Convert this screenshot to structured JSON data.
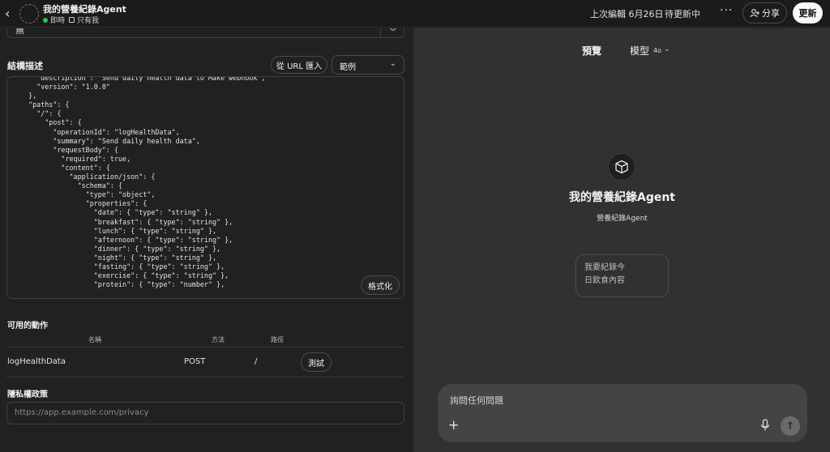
{
  "header": {
    "title": "我的營養紀錄Agent",
    "status": "即時",
    "visibility": "只有我",
    "last_edited": "上次編輯 6月26日",
    "pending": "待更新中",
    "more": "···",
    "share_label": "分享",
    "update_label": "更新"
  },
  "auth": {
    "value": "無"
  },
  "schema": {
    "label": "結構描述",
    "import_label": "從 URL 匯入",
    "example_label": "範例",
    "code_lines": [
      "    \"description\": \"Send daily health data to Make webhook\",",
      "    \"version\": \"1.0.0\"",
      "  },",
      "  \"paths\": {",
      "    \"/\": {",
      "      \"post\": {",
      "        \"operationId\": \"logHealthData\",",
      "        \"summary\": \"Send daily health data\",",
      "        \"requestBody\": {",
      "          \"required\": true,",
      "          \"content\": {",
      "            \"application/json\": {",
      "              \"schema\": {",
      "                \"type\": \"object\",",
      "                \"properties\": {",
      "                  \"date\": { \"type\": \"string\" },",
      "                  \"breakfast\": { \"type\": \"string\" },",
      "                  \"lunch\": { \"type\": \"string\" },",
      "                  \"afternoon\": { \"type\": \"string\" },",
      "                  \"dinner\": { \"type\": \"string\" },",
      "                  \"night\": { \"type\": \"string\" },",
      "                  \"fasting\": { \"type\": \"string\" },",
      "                  \"exercise\": { \"type\": \"string\" },",
      "                  \"protein\": { \"type\": \"number\" },"
    ],
    "format_label": "格式化"
  },
  "actions": {
    "label": "可用的動作",
    "col_name": "名稱",
    "col_method": "方法",
    "col_path": "路徑",
    "rows": [
      {
        "name": "logHealthData",
        "method": "POST",
        "path": "/",
        "test_label": "測試"
      }
    ]
  },
  "privacy": {
    "label": "隱私權政策",
    "placeholder": "https://app.example.com/privacy"
  },
  "preview": {
    "label": "預覽",
    "model_label": "模型",
    "model_version": "4o",
    "agent_name": "我的營養紀錄Agent",
    "agent_description": "營養紀錄Agent",
    "starter_line1": "我要紀錄今",
    "starter_line2": "日飲食內容",
    "composer_placeholder": "詢問任何問題"
  },
  "colors": {
    "background": "#212121",
    "preview_background": "#313131",
    "live_dot": "#2fbf5a",
    "update_button": "#fafafa"
  }
}
